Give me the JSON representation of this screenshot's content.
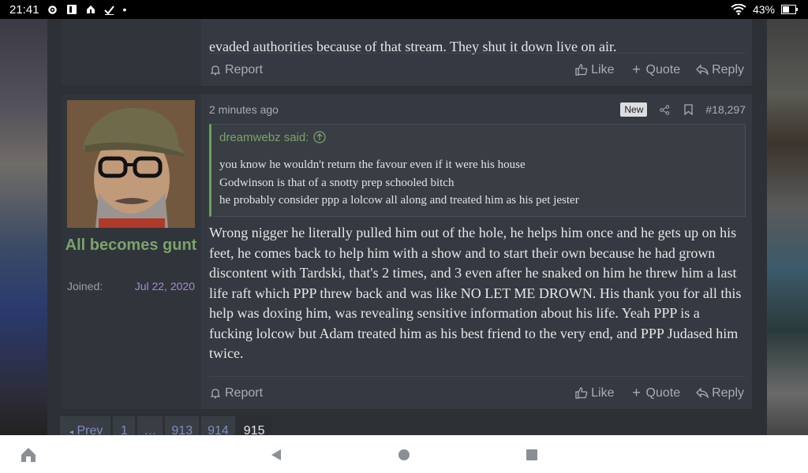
{
  "status_bar": {
    "time": "21:41",
    "battery": "43%"
  },
  "previous_post": {
    "text_tail": "evaded authorities because of that stream. They shut it down live on air.",
    "actions": {
      "report": "Report",
      "like": "Like",
      "quote": "Quote",
      "reply": "Reply"
    }
  },
  "post": {
    "user": {
      "name": "All becomes gunt",
      "joined_label": "Joined:",
      "joined_date": "Jul 22, 2020"
    },
    "time": "2 minutes ago",
    "badge": "New",
    "post_number": "#18,297",
    "quote": {
      "author": "dreamwebz said:",
      "lines": [
        "you know he wouldn't return the favour even if it were his house",
        "Godwinson is that of a snotty prep schooled bitch",
        "he probably consider ppp a lolcow all along and treated him as his pet jester"
      ]
    },
    "body": "Wrong nigger he literally pulled him out of the hole, he helps him once and he gets up on his feet, he comes back to help him with a show and to start their own because he had grown discontent with Tardski, that's 2 times, and 3 even after he snaked on him he threw him a last life raft which PPP threw back and was like NO LET ME DROWN. His thank you for all this help was doxing him, was revealing sensitive information about his life. Yeah PPP is a fucking lolcow but Adam treated him as his best friend to the very end, and PPP Judased him twice.",
    "actions": {
      "report": "Report",
      "like": "Like",
      "quote": "Quote",
      "reply": "Reply"
    }
  },
  "pagination": {
    "prev": "Prev",
    "pages": [
      "1",
      "…",
      "913",
      "914",
      "915"
    ],
    "current": "915"
  }
}
